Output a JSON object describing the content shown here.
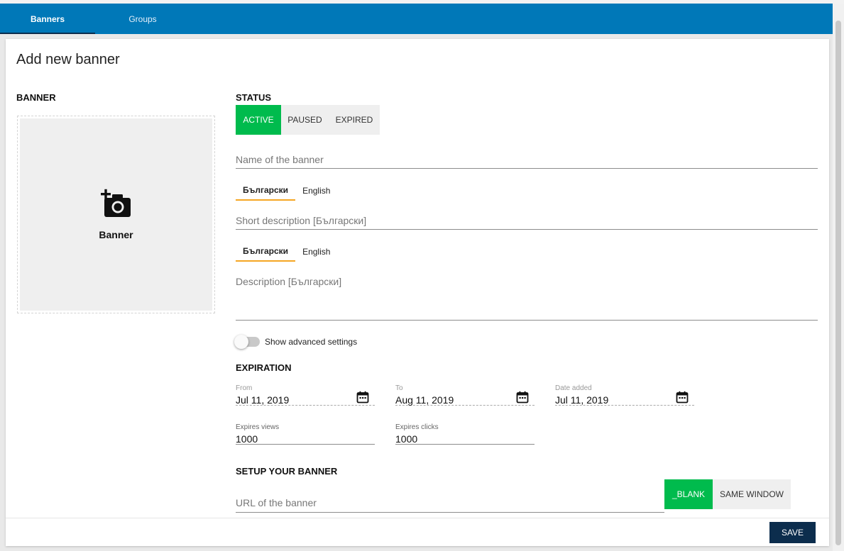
{
  "nav": {
    "tabs": [
      {
        "label": "Banners",
        "active": true
      },
      {
        "label": "Groups",
        "active": false
      }
    ]
  },
  "page": {
    "title": "Add new banner"
  },
  "banner": {
    "heading": "BANNER",
    "upload_label": "Banner",
    "upload_icon": "add-a-photo-icon"
  },
  "status": {
    "heading": "STATUS",
    "options": [
      "ACTIVE",
      "PAUSED",
      "EXPIRED"
    ],
    "selected": "ACTIVE"
  },
  "form": {
    "name_placeholder": "Name of the banner",
    "lang_tabs": [
      "Български",
      "English"
    ],
    "selected_lang": "Български",
    "short_desc_placeholder": "Short description [Български]",
    "desc_placeholder": "Description [Български]",
    "advanced_toggle_label": "Show advanced settings",
    "advanced_enabled": false
  },
  "expiration": {
    "heading": "EXPIRATION",
    "from_label": "From",
    "from_value": "Jul 11, 2019",
    "to_label": "To",
    "to_value": "Aug 11, 2019",
    "date_added_label": "Date added",
    "date_added_value": "Jul 11, 2019",
    "expires_views_label": "Expires views",
    "expires_views_value": "1000",
    "expires_clicks_label": "Expires clicks",
    "expires_clicks_value": "1000"
  },
  "setup": {
    "heading": "SETUP YOUR BANNER",
    "url_placeholder": "URL of the banner",
    "target_options": [
      "_BLANK",
      "SAME WINDOW"
    ],
    "selected_target": "_BLANK"
  },
  "footer": {
    "save_label": "SAVE"
  },
  "colors": {
    "app_bar": "#0078b8",
    "active_green": "#00bb4d",
    "lang_underline": "#f5a623",
    "save_button": "#0c2d4d"
  }
}
